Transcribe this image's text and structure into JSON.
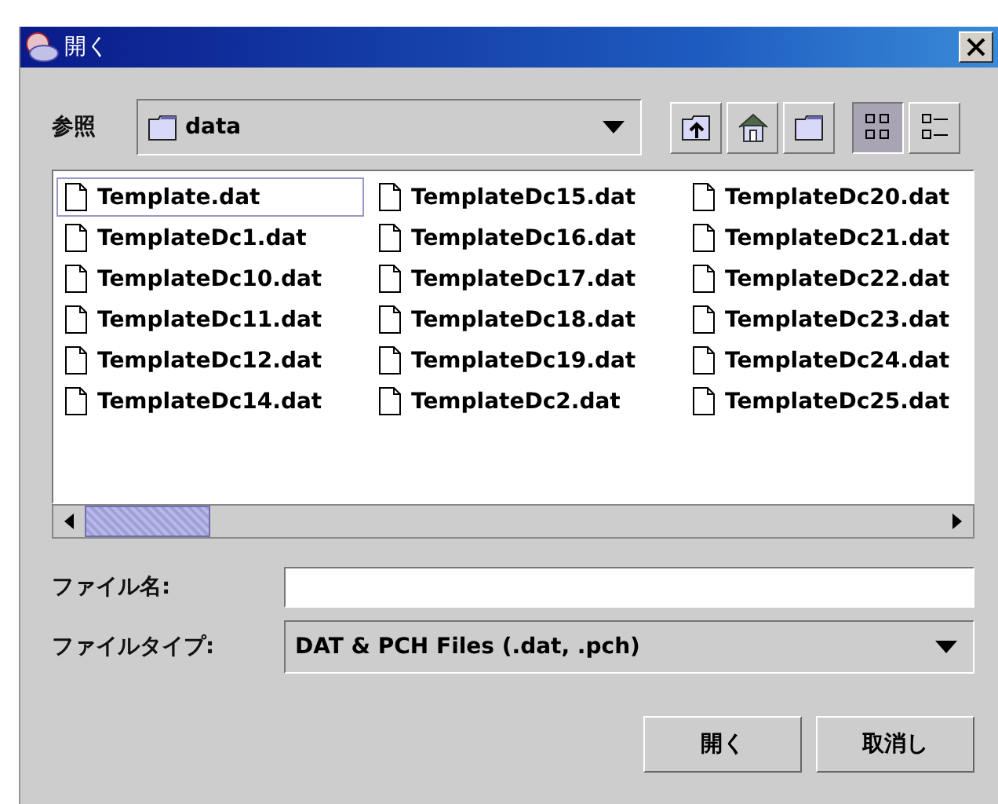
{
  "window": {
    "title": "開く"
  },
  "look_in": {
    "label": "参照",
    "value": "data"
  },
  "toolbar": [
    {
      "kind": "up"
    },
    {
      "kind": "home"
    },
    {
      "kind": "new-folder"
    },
    {
      "kind": "list",
      "selected": true
    },
    {
      "kind": "details",
      "selected": false
    }
  ],
  "files": [
    {
      "name": "Template.dat",
      "selected": true
    },
    {
      "name": "TemplateDc1.dat",
      "selected": false
    },
    {
      "name": "TemplateDc10.dat",
      "selected": false
    },
    {
      "name": "TemplateDc11.dat",
      "selected": false
    },
    {
      "name": "TemplateDc12.dat",
      "selected": false
    },
    {
      "name": "TemplateDc14.dat",
      "selected": false
    },
    {
      "name": "TemplateDc15.dat",
      "selected": false
    },
    {
      "name": "TemplateDc16.dat",
      "selected": false
    },
    {
      "name": "TemplateDc17.dat",
      "selected": false
    },
    {
      "name": "TemplateDc18.dat",
      "selected": false
    },
    {
      "name": "TemplateDc19.dat",
      "selected": false
    },
    {
      "name": "TemplateDc2.dat",
      "selected": false
    },
    {
      "name": "TemplateDc20.dat",
      "selected": false
    },
    {
      "name": "TemplateDc21.dat",
      "selected": false
    },
    {
      "name": "TemplateDc22.dat",
      "selected": false
    },
    {
      "name": "TemplateDc23.dat",
      "selected": false
    },
    {
      "name": "TemplateDc24.dat",
      "selected": false
    },
    {
      "name": "TemplateDc25.dat",
      "selected": false
    }
  ],
  "file_name": {
    "label": "ファイル名:"
  },
  "file_type": {
    "label": "ファイルタイプ:",
    "value": "DAT & PCH Files (.dat, .pch)"
  },
  "buttons": [
    "開く",
    "取消し"
  ]
}
